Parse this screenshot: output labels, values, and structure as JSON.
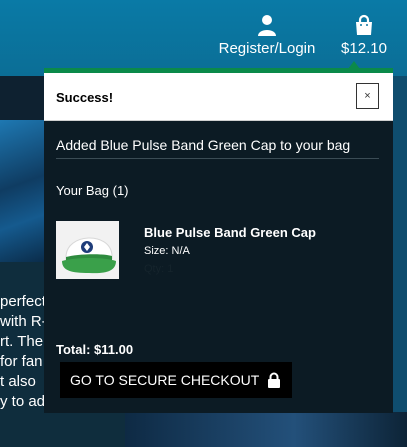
{
  "header": {
    "login_label": "Register/Login",
    "bag_total": "$12.10",
    "user_icon": "user-icon",
    "bag_icon": "shopping-bag-icon"
  },
  "background_text": {
    "lines": [
      "perfect",
      "with R-",
      "rt. The",
      "for fan",
      "t also",
      "y to add a pop"
    ]
  },
  "popup": {
    "title": "Success!",
    "close_label": "×",
    "message": "Added Blue Pulse Band Green Cap to your bag",
    "bag_title": "Your Bag (1)",
    "item": {
      "name": "Blue Pulse Band Green Cap",
      "size": "Size: N/A",
      "qty": "Qty: 1",
      "image_icon": "green-cap-image"
    },
    "total": "Total: $11.00",
    "checkout_label": "GO TO SECURE CHECKOUT",
    "checkout_icon": "lock-icon"
  },
  "colors": {
    "header_bg": "#0b76a0",
    "accent_green": "#0b8a4a",
    "popup_bg": "#0c1b24",
    "button_bg": "#000000"
  }
}
